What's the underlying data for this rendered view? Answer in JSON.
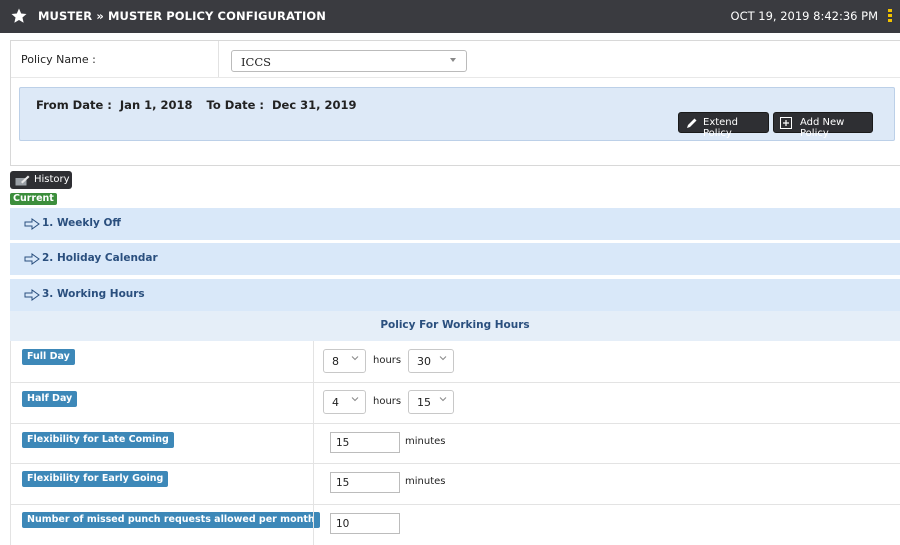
{
  "header": {
    "title": "MUSTER » MUSTER POLICY CONFIGURATION",
    "datetime": "OCT 19, 2019  8:42:36 PM",
    "accent": "#f2c200"
  },
  "policy": {
    "name_label": "Policy Name :",
    "selected": "ICCS",
    "from_label": "From Date :",
    "from_value": "Jan 1, 2018",
    "to_label": "To Date :",
    "to_value": "Dec 31, 2019",
    "extend_label": "Extend Policy",
    "add_label": "Add New Policy"
  },
  "history": {
    "button_label": "History",
    "current_badge": "Current"
  },
  "sections": [
    {
      "label": "1. Weekly Off"
    },
    {
      "label": "2. Holiday Calendar"
    },
    {
      "label": "3. Working Hours"
    }
  ],
  "working_hours": {
    "heading": "Policy For Working Hours",
    "rows": [
      {
        "label": "Full Day",
        "hours": "8",
        "hours_unit": "hours",
        "minutes": "30"
      },
      {
        "label": "Half Day",
        "hours": "4",
        "hours_unit": "hours",
        "minutes": "15"
      },
      {
        "label": "Flexibility for Late Coming",
        "value": "15",
        "unit": "minutes"
      },
      {
        "label": "Flexibility for Early Going",
        "value": "15",
        "unit": "minutes"
      },
      {
        "label": "Number of missed punch requests allowed per month",
        "value": "10"
      }
    ]
  }
}
